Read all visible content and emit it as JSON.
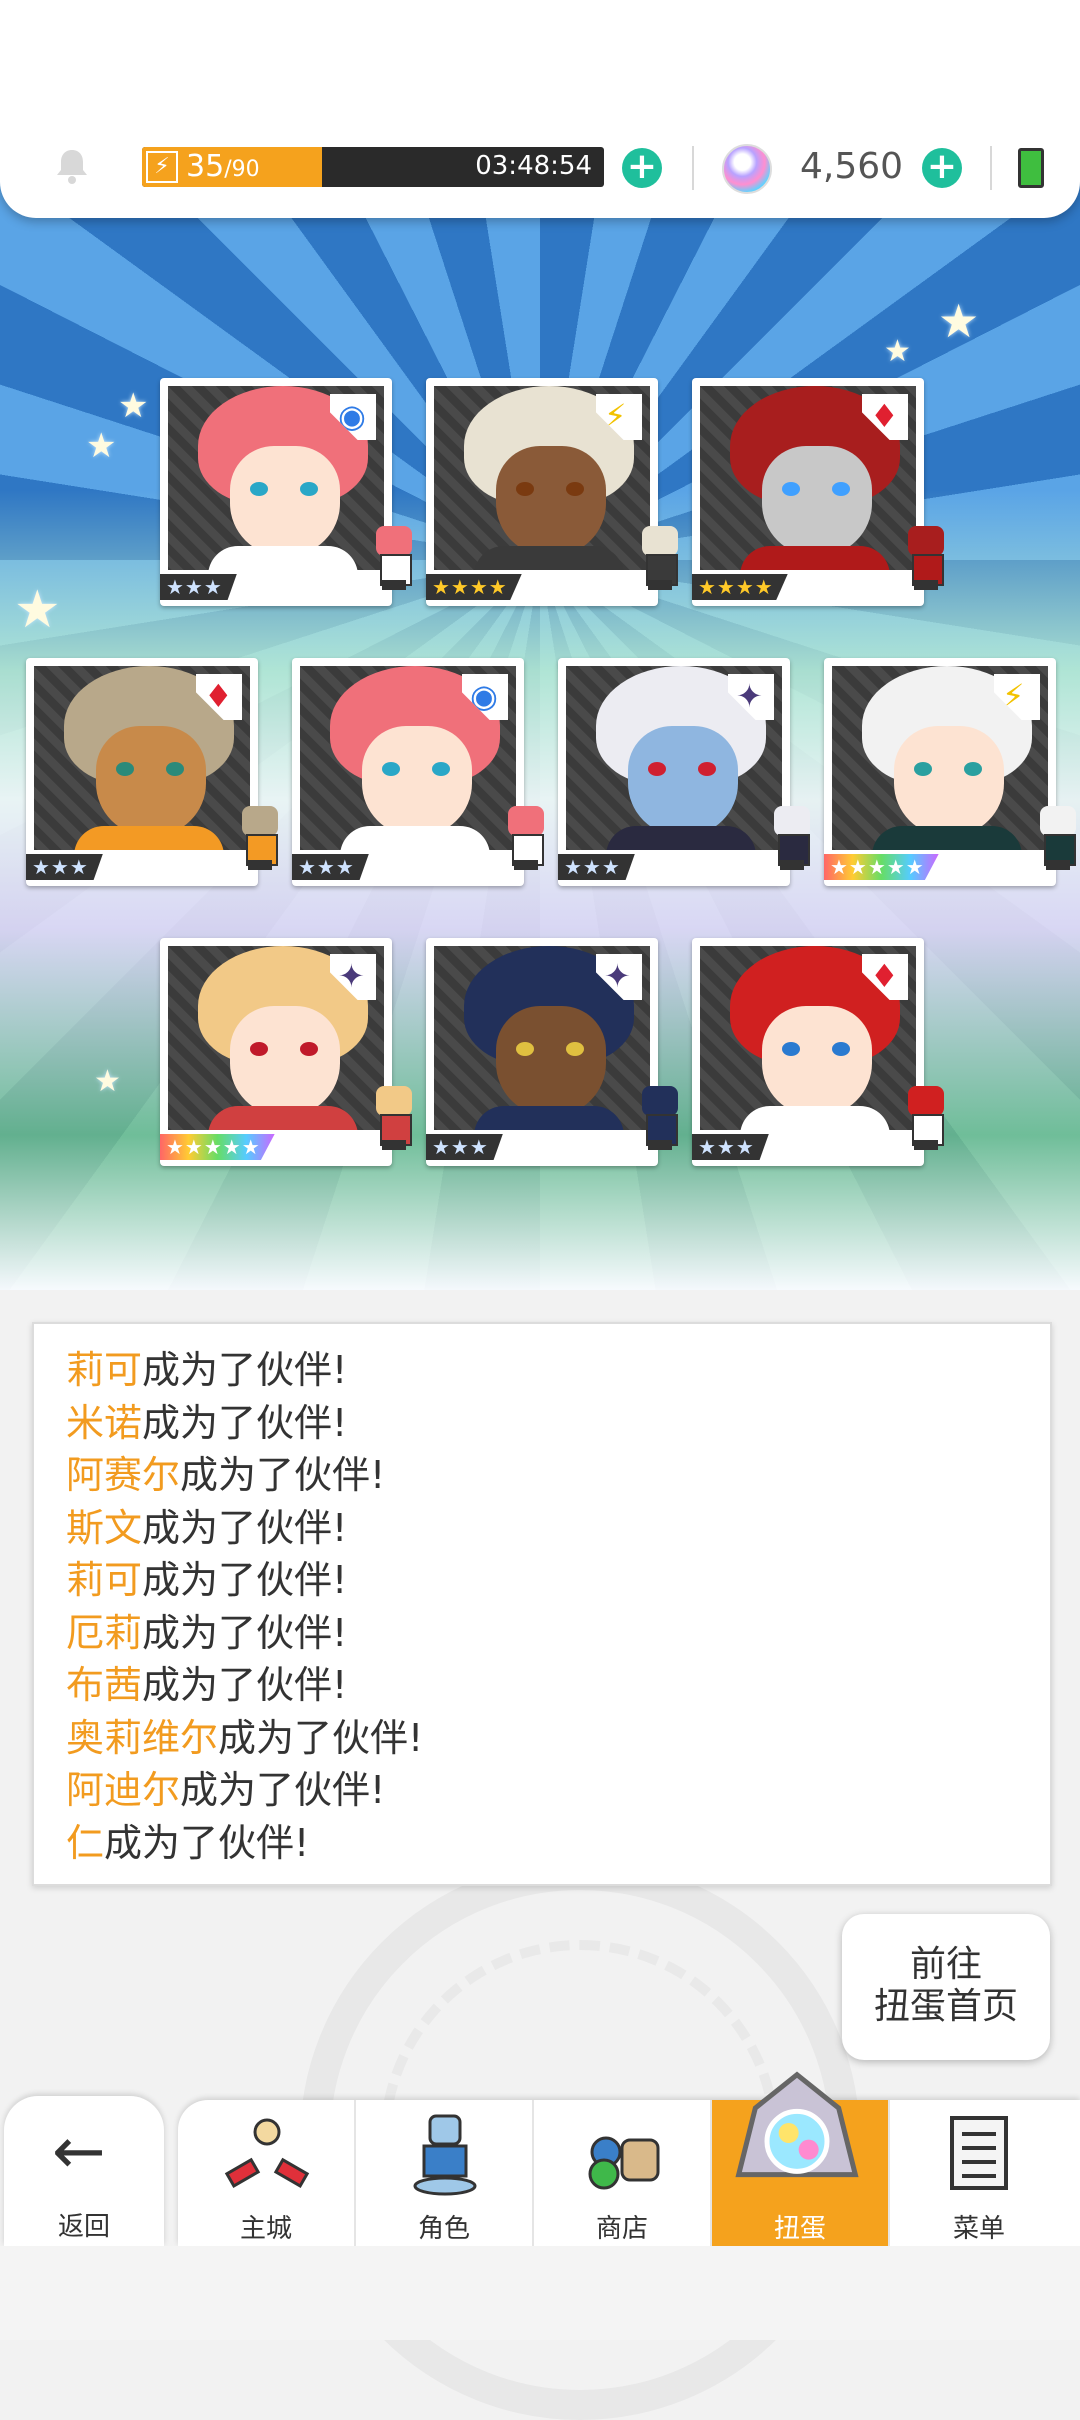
{
  "topbar": {
    "stamina_current": "35",
    "stamina_max": "/90",
    "stamina_fraction": 0.389,
    "timer": "03:48:54",
    "gems": "4,560"
  },
  "cards": [
    {
      "name": "莉可",
      "rank": "★★★",
      "rank_style": "silver",
      "attr": "water",
      "hair": "#f0707a",
      "skin": "#fde3d2",
      "eye": "#2aa7c7",
      "body": "#fff"
    },
    {
      "name": "米诺",
      "rank": "★★★★",
      "rank_style": "gold",
      "attr": "light",
      "hair": "#e8e2d2",
      "skin": "#8a5a38",
      "eye": "#7a3a10",
      "body": "#3a3a3a"
    },
    {
      "name": "阿赛尔",
      "rank": "★★★★",
      "rank_style": "gold",
      "attr": "fire",
      "hair": "#a81e1e",
      "skin": "#c8c8c8",
      "eye": "#40a0ff",
      "body": "#b01a1a"
    },
    {
      "name": "斯文",
      "rank": "★★★",
      "rank_style": "silver",
      "attr": "fire",
      "hair": "#b8a88a",
      "skin": "#c88a4a",
      "eye": "#2a8a7a",
      "body": "#f39a24"
    },
    {
      "name": "莉可",
      "rank": "★★★",
      "rank_style": "silver",
      "attr": "water",
      "hair": "#f0707a",
      "skin": "#fde3d2",
      "eye": "#2aa7c7",
      "body": "#fff"
    },
    {
      "name": "厄莉",
      "rank": "★★★",
      "rank_style": "silver",
      "attr": "dark",
      "hair": "#ececf2",
      "skin": "#8fb6e0",
      "eye": "#d02030",
      "body": "#2a2a40"
    },
    {
      "name": "布茜",
      "rank": "★★★★★",
      "rank_style": "rainbow",
      "attr": "light",
      "hair": "#f2f2f2",
      "skin": "#fde3d2",
      "eye": "#2aa0a0",
      "body": "#1a3a3a"
    },
    {
      "name": "奥莉维尔",
      "rank": "★★★★★",
      "rank_style": "rainbow",
      "attr": "dark",
      "hair": "#f2c987",
      "skin": "#fde3d2",
      "eye": "#c01a2a",
      "body": "#d04040"
    },
    {
      "name": "阿迪尔",
      "rank": "★★★",
      "rank_style": "silver",
      "attr": "dark",
      "hair": "#22305a",
      "skin": "#7a5030",
      "eye": "#e0c040",
      "body": "#22305a"
    },
    {
      "name": "仁",
      "rank": "★★★",
      "rank_style": "silver",
      "attr": "fire",
      "hair": "#d02020",
      "skin": "#fde3d2",
      "eye": "#2a7ad0",
      "body": "#fff"
    }
  ],
  "attr_icons": {
    "water": {
      "glyph": "◉",
      "color": "#2f7be6"
    },
    "light": {
      "glyph": "⚡",
      "color": "#f2c200"
    },
    "fire": {
      "glyph": "♦",
      "color": "#e02030"
    },
    "dark": {
      "glyph": "✦",
      "color": "#4a3a7a"
    }
  },
  "log": {
    "suffix": "成为了伙伴!",
    "names": [
      "莉可",
      "米诺",
      "阿赛尔",
      "斯文",
      "莉可",
      "厄莉",
      "布茜",
      "奥莉维尔",
      "阿迪尔",
      "仁"
    ]
  },
  "goto_button": {
    "line1": "前往",
    "line2": "扭蛋首页"
  },
  "nav": {
    "back": "返回",
    "tabs": [
      "主城",
      "角色",
      "商店",
      "扭蛋",
      "菜单"
    ],
    "active": "扭蛋"
  },
  "colors": {
    "accent": "#f5a21d",
    "plus": "#1fbf9c",
    "name_highlight": "#f29b1f"
  }
}
